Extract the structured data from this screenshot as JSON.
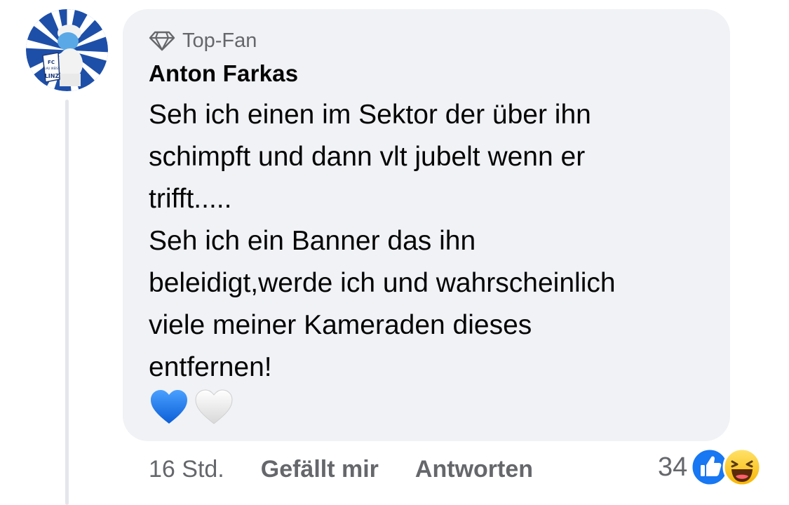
{
  "comment": {
    "badge": "Top-Fan",
    "author": "Anton Farkas",
    "lines": [
      "Seh ich einen im Sektor der über ihn",
      "schimpft und dann vlt jubelt wenn er",
      "trifft.....",
      "Seh ich ein Banner das ihn",
      "beleidigt,werde ich und wahrscheinlich",
      "viele meiner Kameraden dieses",
      "entfernen!"
    ],
    "emojis": [
      "blue-heart",
      "white-heart"
    ]
  },
  "avatar": {
    "crest_text": [
      "FC",
      "BLAU WEISS",
      "LINZ"
    ]
  },
  "actions": {
    "time": "16 Std.",
    "like_label": "Gefällt mir",
    "reply_label": "Antworten"
  },
  "reactions": {
    "count": "34",
    "icons": [
      "like-icon",
      "haha-icon"
    ]
  },
  "colors": {
    "bubble": "#f0f2f5",
    "meta_text": "#65676b",
    "text": "#050505",
    "like_blue": "#1877f2",
    "heart_blue": "#1e6fe8"
  }
}
